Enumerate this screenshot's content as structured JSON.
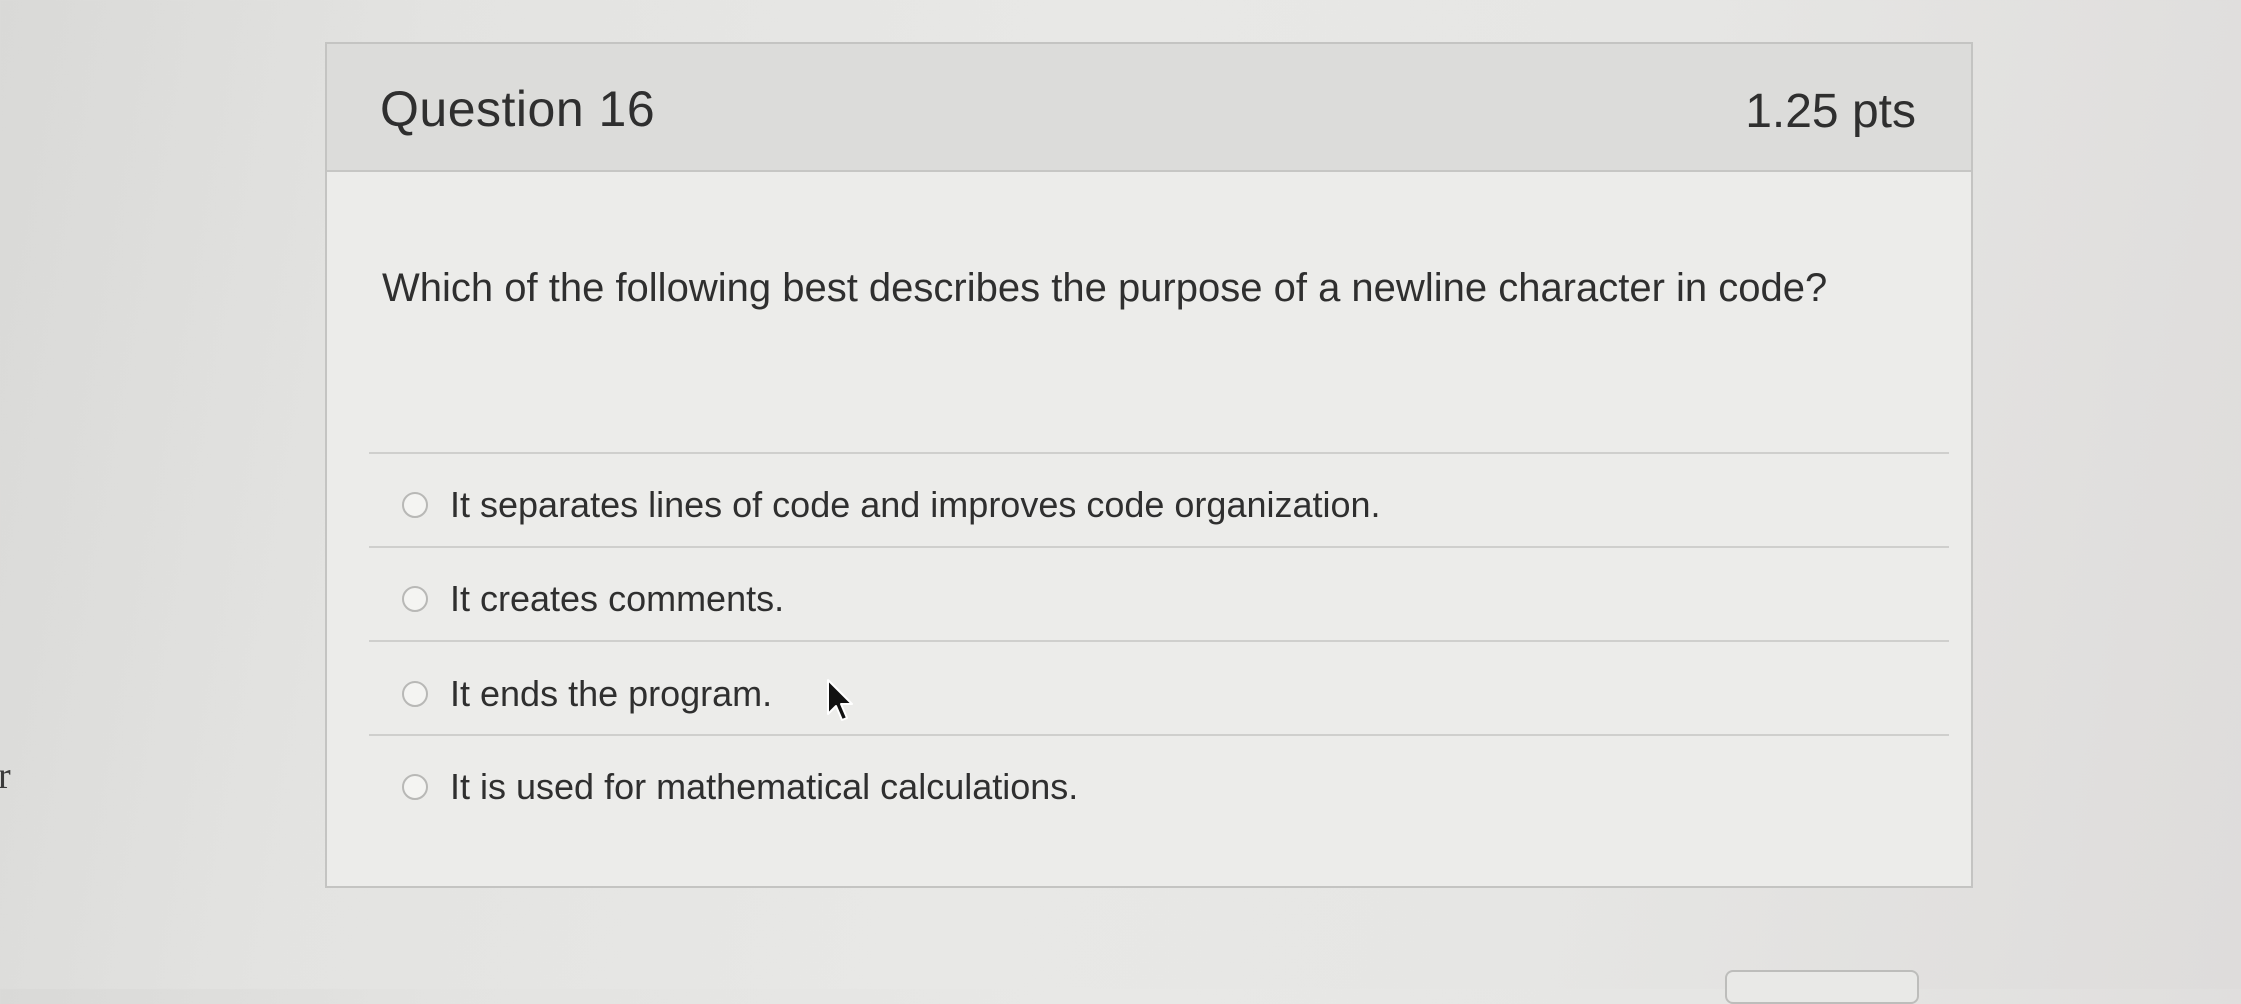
{
  "page": {
    "stray_char": "r"
  },
  "question": {
    "title": "Question 16",
    "points": "1.25 pts",
    "text": "Which of the following best describes the purpose of a newline character in code?",
    "answers": [
      {
        "label": "It separates lines of code and improves code organization.",
        "selected": false
      },
      {
        "label": "It creates comments.",
        "selected": false
      },
      {
        "label": "It ends the program.",
        "selected": false
      },
      {
        "label": "It is used for mathematical calculations.",
        "selected": false
      }
    ]
  },
  "icons": {
    "cursor": "arrow-cursor-icon",
    "radio": "radio-button-icon"
  },
  "colors": {
    "header_background": "#dcdcda",
    "card_background": "#ececea",
    "text": "#2f2f2f",
    "border": "#c4c4c2"
  }
}
